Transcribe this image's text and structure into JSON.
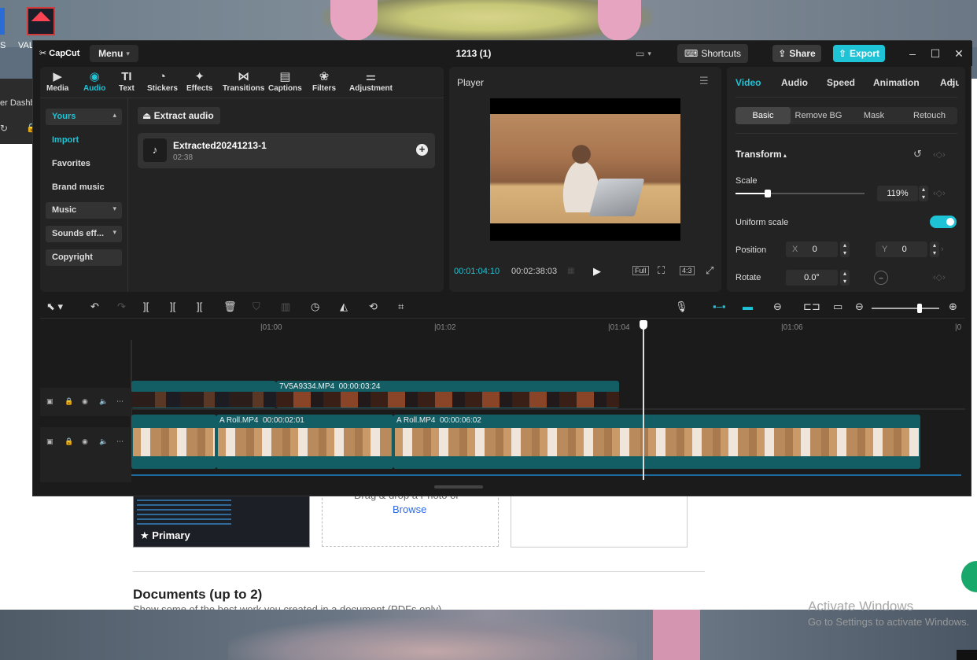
{
  "desktop": {
    "left_icon_label": "S",
    "valorant_label": "VAL",
    "activate_title": "Activate Windows",
    "activate_sub": "Go to Settings to activate Windows."
  },
  "browser": {
    "tab_text": "er Dashb",
    "primary_label": "Primary",
    "drag_text": "Drag & drop a Photo or",
    "browse": "Browse",
    "docs_title": "Documents (up to 2)",
    "docs_sub": "Show some of the best work you created in a document (PDFs only)"
  },
  "app": {
    "logo": "CapCut",
    "menu": "Menu",
    "project_title": "1213 (1)",
    "shortcuts": "Shortcuts",
    "share": "Share",
    "export": "Export"
  },
  "tool_tabs": [
    {
      "label": "Media",
      "icon": "media-icon"
    },
    {
      "label": "Audio",
      "icon": "audio-icon"
    },
    {
      "label": "Text",
      "icon": "text-icon"
    },
    {
      "label": "Stickers",
      "icon": "stickers-icon"
    },
    {
      "label": "Effects",
      "icon": "effects-icon"
    },
    {
      "label": "Transitions",
      "icon": "transitions-icon"
    },
    {
      "label": "Captions",
      "icon": "captions-icon"
    },
    {
      "label": "Filters",
      "icon": "filters-icon"
    },
    {
      "label": "Adjustment",
      "icon": "adjustment-icon"
    }
  ],
  "active_tool_tab": "Audio",
  "side_categories": [
    "Yours",
    "Import",
    "Favorites",
    "Brand music",
    "Music",
    "Sounds eff...",
    "Copyright"
  ],
  "audio_panel": {
    "extract": "Extract audio",
    "item_name": "Extracted20241213-1",
    "item_duration": "02:38"
  },
  "player": {
    "title": "Player",
    "current_time": "00:01:04:10",
    "total_time": "00:02:38:03",
    "full": "Full",
    "ratio": "4:3"
  },
  "props": {
    "tabs": [
      "Video",
      "Audio",
      "Speed",
      "Animation",
      "Adjus"
    ],
    "active_tab": "Video",
    "sub_tabs": [
      "Basic",
      "Remove BG",
      "Mask",
      "Retouch"
    ],
    "active_sub_tab": "Basic",
    "transform": "Transform",
    "scale_label": "Scale",
    "scale_value": "119%",
    "scale_fraction": 0.25,
    "uniform_scale": "Uniform scale",
    "uniform_on": true,
    "position_label": "Position",
    "x_label": "X",
    "x_value": "0",
    "y_label": "Y",
    "y_value": "0",
    "rotate_label": "Rotate",
    "rotate_value": "0.0°"
  },
  "timeline": {
    "ticks": [
      "|01:00",
      "|01:02",
      "|01:04",
      "|01:06",
      "|0"
    ],
    "overlay_clip": {
      "name": "7V5A9334.MP4",
      "duration": "00:00:03:24"
    },
    "main_clips": [
      {
        "name": "A Roll.MP4",
        "duration": "00:00:02:01"
      },
      {
        "name": "A Roll.MP4",
        "duration": "00:00:06:02"
      }
    ]
  },
  "colors": {
    "accent": "#1fc3d6",
    "clip": "#125e64",
    "panel": "#232323"
  }
}
